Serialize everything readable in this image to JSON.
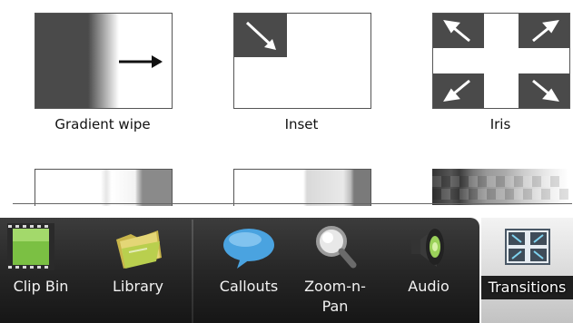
{
  "gallery": {
    "tiles": [
      {
        "label": "Gradient wipe"
      },
      {
        "label": "Inset"
      },
      {
        "label": "Iris"
      }
    ]
  },
  "toolbar": {
    "tools": [
      {
        "label": "Clip Bin",
        "icon": "film-strip-icon"
      },
      {
        "label": "Library",
        "icon": "folder-icon"
      },
      {
        "label": "Callouts",
        "icon": "speech-bubble-icon"
      },
      {
        "label": "Zoom-n-Pan",
        "label_line1": "Zoom-n-",
        "label_line2": "Pan",
        "icon": "magnifier-icon"
      },
      {
        "label": "Audio",
        "icon": "speaker-icon"
      },
      {
        "label": "Transitions",
        "icon": "transitions-icon",
        "active": true
      }
    ]
  },
  "colors": {
    "toolbar_dark": "#262626",
    "active_tab": "#d7d7d7",
    "callout_blue": "#4aa3e0",
    "clipbin_green": "#7bc043"
  }
}
